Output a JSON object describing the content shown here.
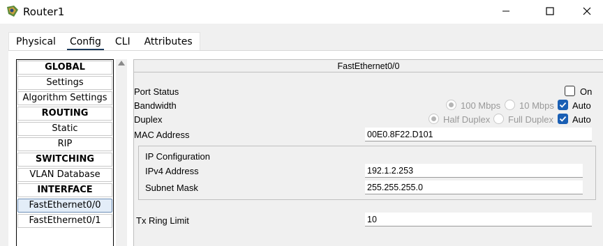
{
  "window": {
    "title": "Router1"
  },
  "tabs": [
    {
      "label": "Physical"
    },
    {
      "label": "Config",
      "active": true
    },
    {
      "label": "CLI"
    },
    {
      "label": "Attributes"
    }
  ],
  "nav": {
    "items": [
      {
        "label": "GLOBAL",
        "header": true
      },
      {
        "label": "Settings"
      },
      {
        "label": "Algorithm Settings"
      },
      {
        "label": "ROUTING",
        "header": true
      },
      {
        "label": "Static"
      },
      {
        "label": "RIP"
      },
      {
        "label": "SWITCHING",
        "header": true
      },
      {
        "label": "VLAN Database"
      },
      {
        "label": "INTERFACE",
        "header": true
      },
      {
        "label": "FastEthernet0/0",
        "selected": true
      },
      {
        "label": "FastEthernet0/1"
      }
    ]
  },
  "panel": {
    "title": "FastEthernet0/0",
    "port_status": {
      "label": "Port Status",
      "on_label": "On",
      "on_checked": false
    },
    "bandwidth": {
      "label": "Bandwidth",
      "opt1": "100 Mbps",
      "opt2": "10 Mbps",
      "auto": "Auto",
      "auto_checked": true
    },
    "duplex": {
      "label": "Duplex",
      "opt1": "Half Duplex",
      "opt2": "Full Duplex",
      "auto": "Auto",
      "auto_checked": true
    },
    "mac": {
      "label": "MAC Address",
      "value": "00E0.8F22.D101"
    },
    "ip": {
      "section_label": "IP Configuration",
      "ipv4_label": "IPv4 Address",
      "ipv4_value": "192.1.2.253",
      "mask_label": "Subnet Mask",
      "mask_value": "255.255.255.0"
    },
    "tx": {
      "label": "Tx Ring Limit",
      "value": "10"
    }
  },
  "colors": {
    "accent": "#1a5fb4",
    "tab_underline": "#1c3a5c",
    "selected_bg": "#e3edf8"
  }
}
